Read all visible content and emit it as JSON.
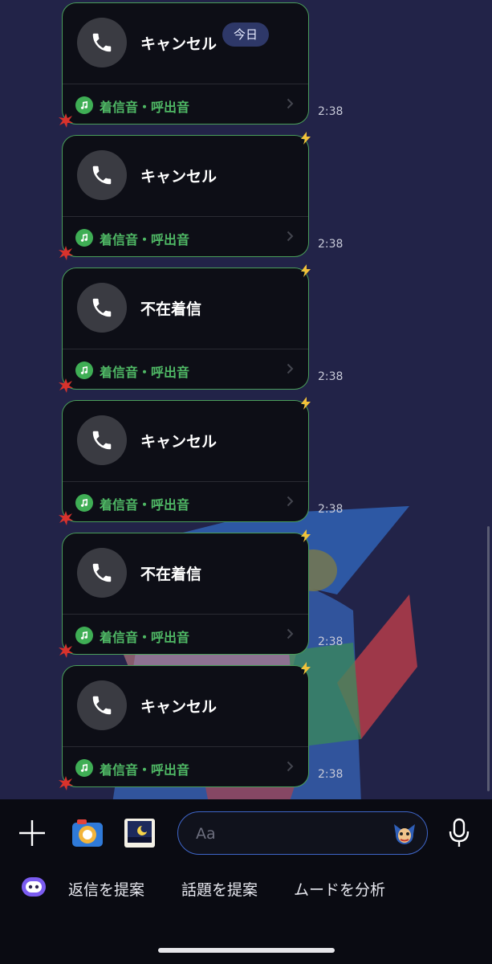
{
  "date_badge": "今日",
  "calls": [
    {
      "title": "キャンセル",
      "ring_label": "着信音・呼出音",
      "time": "2:38"
    },
    {
      "title": "キャンセル",
      "ring_label": "着信音・呼出音",
      "time": "2:38"
    },
    {
      "title": "不在着信",
      "ring_label": "着信音・呼出音",
      "time": "2:38"
    },
    {
      "title": "キャンセル",
      "ring_label": "着信音・呼出音",
      "time": "2:38"
    },
    {
      "title": "不在着信",
      "ring_label": "着信音・呼出音",
      "time": "2:38"
    },
    {
      "title": "キャンセル",
      "ring_label": "着信音・呼出音",
      "time": "2:38"
    }
  ],
  "composer": {
    "placeholder": "Aa",
    "icons": [
      "plus-icon",
      "camera-icon",
      "photo-icon",
      "sticker-icon",
      "microphone-icon"
    ]
  },
  "suggestions": {
    "reply": "返信を提案",
    "topic": "話題を提案",
    "mood": "ムードを分析"
  },
  "colors": {
    "background": "#222348",
    "card": "#0d0e16",
    "card_border": "#4a9e5a",
    "ring_text": "#4fb865",
    "input_border": "#3f66c9"
  }
}
